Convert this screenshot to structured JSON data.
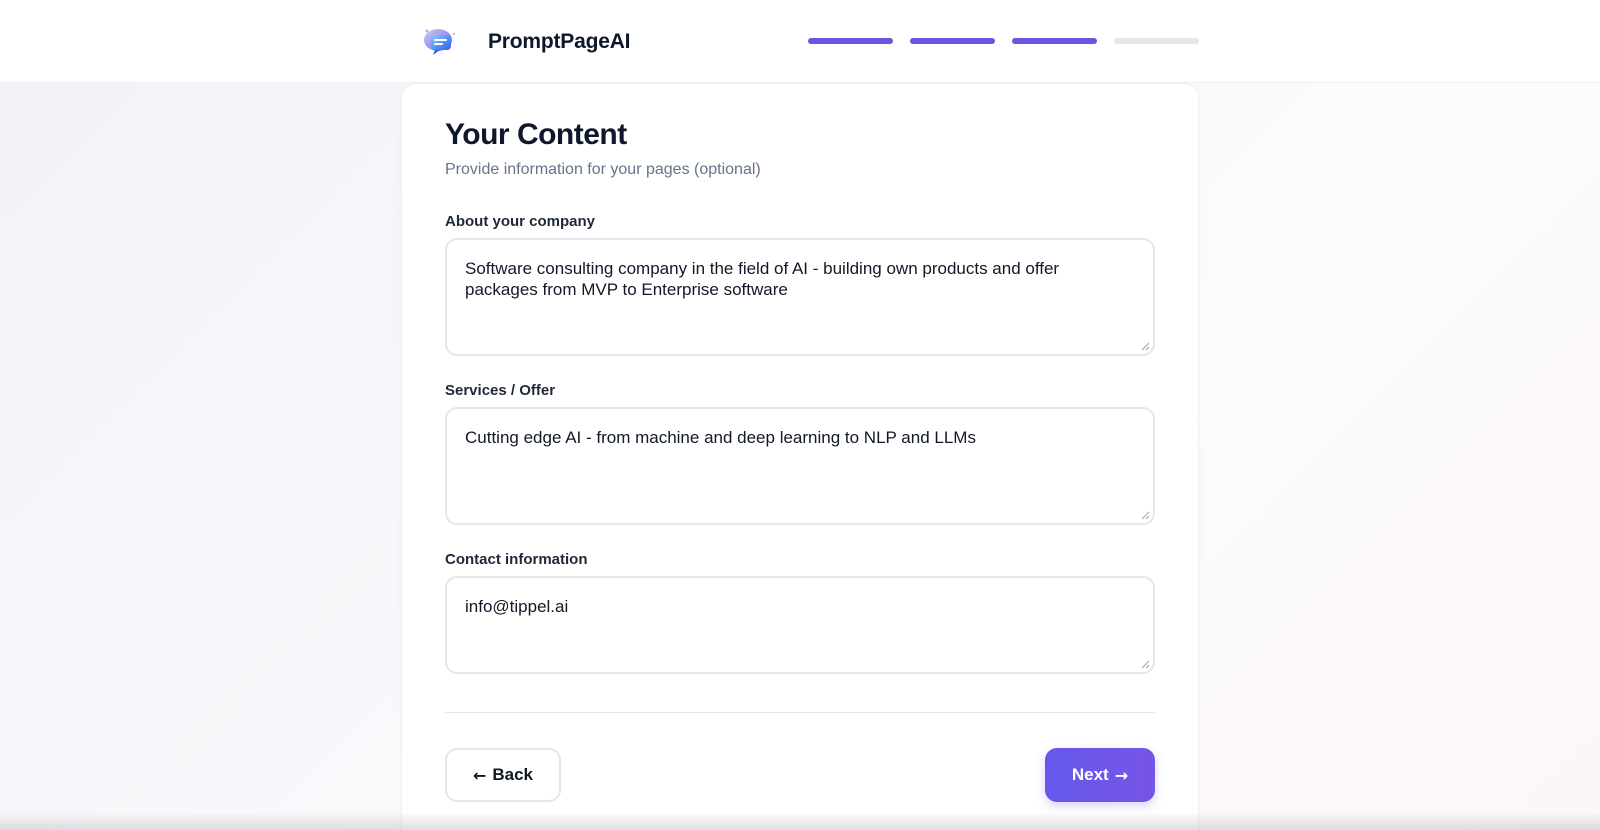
{
  "header": {
    "brand_name": "PromptPageAI",
    "logo_icon": "chat-bubbles-logo-icon",
    "progress": {
      "total_steps": 4,
      "completed_steps": 3
    }
  },
  "main": {
    "title": "Your Content",
    "subtitle": "Provide information for your pages (optional)",
    "fields": [
      {
        "label": "About your company",
        "value": "Software consulting company in the field of AI - building own products and offer packages from MVP to Enterprise software",
        "placeholder": ""
      },
      {
        "label": "Services / Offer",
        "value": "Cutting edge AI - from machine and deep learning to NLP and LLMs",
        "placeholder": ""
      },
      {
        "label": "Contact information",
        "value": "info@tippel.ai",
        "placeholder": ""
      }
    ]
  },
  "actions": {
    "back_label": "Back",
    "back_icon": "arrow-left-icon",
    "next_label": "Next",
    "next_icon": "arrow-right-icon"
  },
  "colors": {
    "accent": "#6a55e0",
    "progress_inactive": "#e5e7eb",
    "text_primary": "#0f172a",
    "text_muted": "#64748b"
  }
}
